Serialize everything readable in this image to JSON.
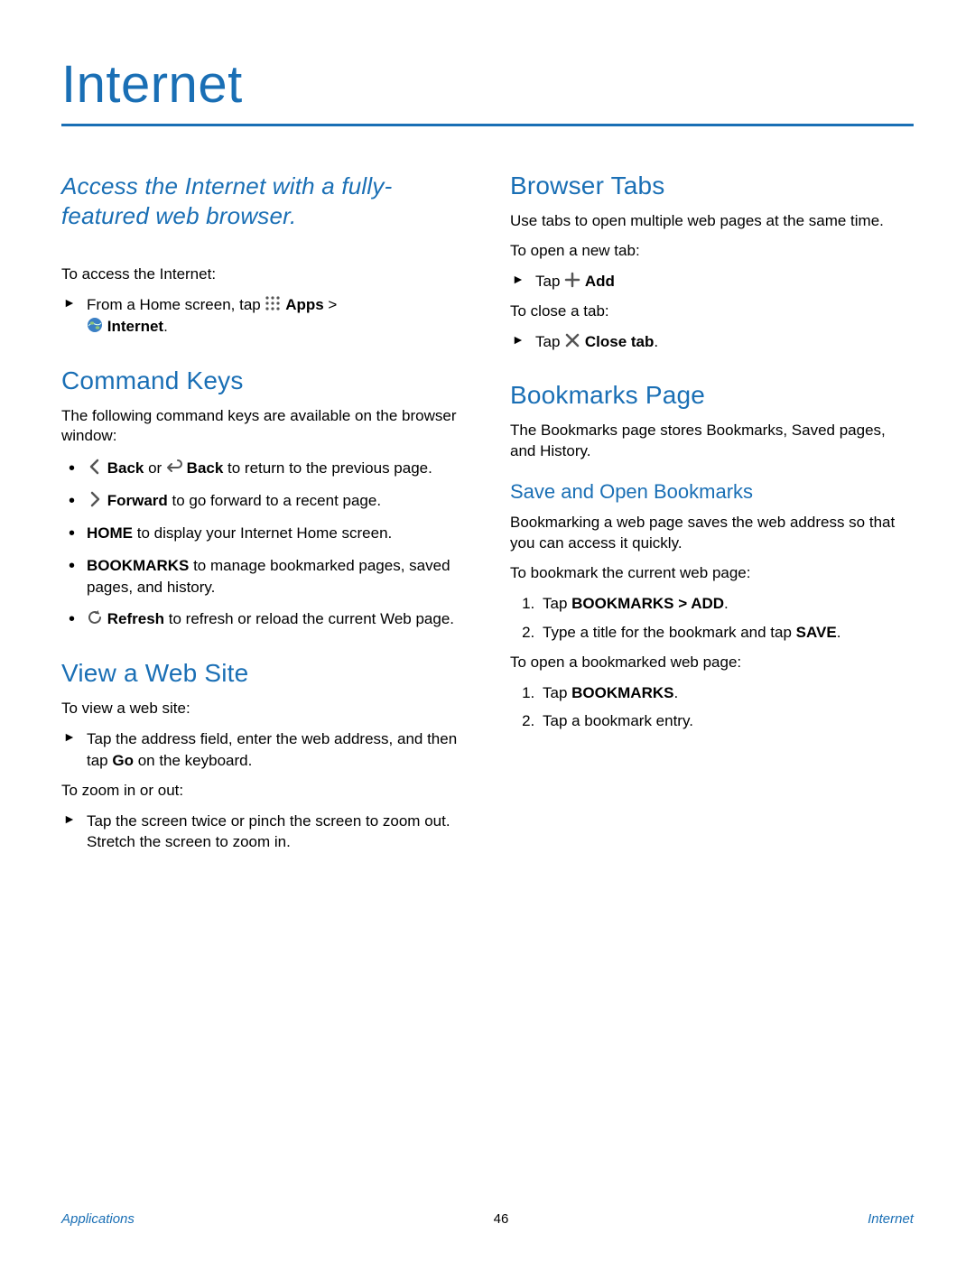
{
  "title": "Internet",
  "left": {
    "intro": "Access the Internet with a fully-featured web browser.",
    "access_label": "To access the Internet:",
    "access_step_prefix": "From a Home screen, tap ",
    "access_apps": "Apps",
    "access_sep": " > ",
    "access_internet": "Internet",
    "access_period": ".",
    "command_keys": {
      "heading": "Command Keys",
      "intro": "The following command keys are available on the browser window:",
      "items": {
        "back_bold1": "Back",
        "back_or": " or ",
        "back_bold2": "Back",
        "back_rest": " to return to the previous page.",
        "forward_bold": "Forward",
        "forward_rest": " to go forward to a recent page.",
        "home_bold": "HOME",
        "home_rest": " to display your Internet Home screen.",
        "bookmarks_bold": "BOOKMARKS",
        "bookmarks_rest": " to manage bookmarked pages, saved pages, and history.",
        "refresh_bold": "Refresh",
        "refresh_rest": " to refresh or reload the current Web page."
      }
    },
    "view_site": {
      "heading": "View a Web Site",
      "to_view": "To view a web site:",
      "step1_a": "Tap the address field, enter the web address, and then tap ",
      "step1_bold": "Go",
      "step1_b": " on the keyboard.",
      "to_zoom": "To zoom in or out:",
      "step2": "Tap the screen twice or pinch the screen to zoom out. Stretch the screen to zoom in."
    }
  },
  "right": {
    "tabs": {
      "heading": "Browser Tabs",
      "intro": "Use tabs to open multiple web pages at the same time.",
      "open_label": "To open a new tab:",
      "open_tap": "Tap ",
      "add_bold": "Add",
      "close_label": "To close a tab:",
      "close_tap": "Tap ",
      "close_bold": "Close tab",
      "close_period": "."
    },
    "bookmarks": {
      "heading": "Bookmarks Page",
      "intro": "The Bookmarks page stores Bookmarks, Saved pages, and History.",
      "sub_heading": "Save and Open Bookmarks",
      "sub_intro": "Bookmarking a web page saves the web address so that you can access it quickly.",
      "to_bookmark": "To bookmark the current web page:",
      "s1_a": "Tap ",
      "s1_bold": "BOOKMARKS > ADD",
      "s1_b": ".",
      "s2_a": "Type a title for the bookmark and tap ",
      "s2_bold": "SAVE",
      "s2_b": ".",
      "to_open": "To open a bookmarked web page:",
      "o1_a": "Tap ",
      "o1_bold": "BOOKMARKS",
      "o1_b": ".",
      "o2": "Tap a bookmark entry."
    }
  },
  "footer": {
    "left": "Applications",
    "center": "46",
    "right": "Internet"
  }
}
